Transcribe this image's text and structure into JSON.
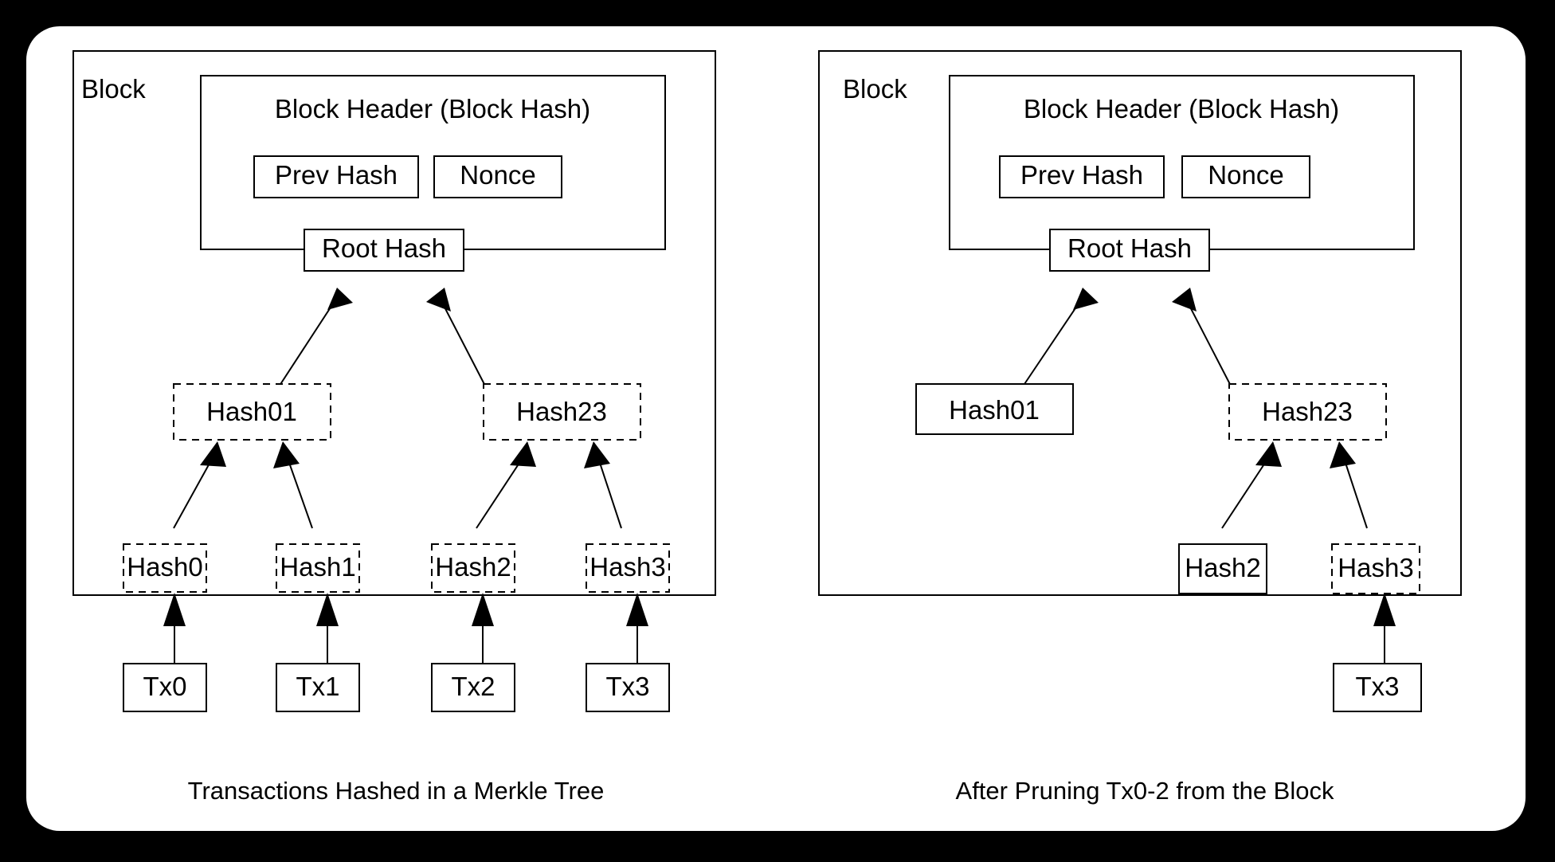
{
  "figure": {
    "background_color": "#000000",
    "card_color": "#ffffff",
    "stroke_color": "#000000"
  },
  "panels": [
    {
      "id": "merkle-tree-panel",
      "block_label": "Block",
      "caption": "Transactions Hashed in a Merkle Tree",
      "header": {
        "title": "Block Header (Block Hash)",
        "fields": [
          {
            "label": "Prev Hash",
            "border": "solid"
          },
          {
            "label": "Nonce",
            "border": "solid"
          },
          {
            "label": "Root Hash",
            "border": "solid"
          }
        ]
      },
      "hash_level_1": [
        {
          "label": "Hash01",
          "border": "dashed"
        },
        {
          "label": "Hash23",
          "border": "dashed"
        }
      ],
      "hash_level_0": [
        {
          "label": "Hash0",
          "border": "dashed"
        },
        {
          "label": "Hash1",
          "border": "dashed"
        },
        {
          "label": "Hash2",
          "border": "dashed"
        },
        {
          "label": "Hash3",
          "border": "dashed"
        }
      ],
      "transactions": [
        {
          "label": "Tx0",
          "border": "solid"
        },
        {
          "label": "Tx1",
          "border": "solid"
        },
        {
          "label": "Tx2",
          "border": "solid"
        },
        {
          "label": "Tx3",
          "border": "solid"
        }
      ]
    },
    {
      "id": "pruned-block-panel",
      "block_label": "Block",
      "caption": "After Pruning Tx0-2 from the Block",
      "header": {
        "title": "Block Header (Block Hash)",
        "fields": [
          {
            "label": "Prev Hash",
            "border": "solid"
          },
          {
            "label": "Nonce",
            "border": "solid"
          },
          {
            "label": "Root Hash",
            "border": "solid"
          }
        ]
      },
      "hash_level_1": [
        {
          "label": "Hash01",
          "border": "solid"
        },
        {
          "label": "Hash23",
          "border": "dashed"
        }
      ],
      "hash_level_0": [
        {
          "label": "Hash2",
          "border": "solid"
        },
        {
          "label": "Hash3",
          "border": "dashed"
        }
      ],
      "transactions": [
        {
          "label": "Tx3",
          "border": "solid"
        }
      ]
    }
  ]
}
